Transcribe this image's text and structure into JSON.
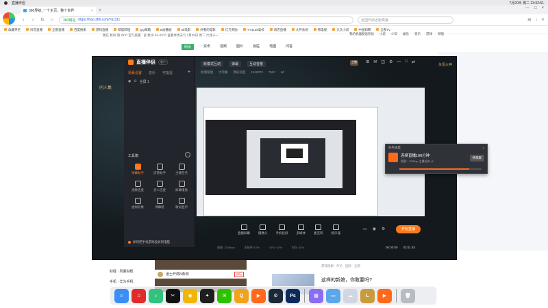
{
  "menubar": {
    "app_name": "直播伴侣",
    "datetime": "7月20日 周二 23:52:51"
  },
  "browser": {
    "tab_title": "360导航_一个主页，整个世界",
    "url_safe": "360网址",
    "url": "https://hao.360.com/?a1111",
    "search_placeholder": "全国开启近距离接",
    "bookmarks": [
      "收藏夹栏",
      "抖音直播",
      "全部直播",
      "百度搜索",
      "游戏直播",
      "哔哩哔哩",
      "QQ邮箱",
      "B站番剧",
      "6k电影",
      "好看的电影",
      "亿元奖励",
      "YY4138高校",
      "商店直播",
      "大伴会场",
      "看电视",
      "久久小说",
      "中国知网",
      "全部TV"
    ],
    "site_header": "我在 杭州  阴 26°C  空气质量 · 良  杭州 24~31°C  查看本周天气  7月20日 周二  六月十一",
    "site_nav": [
      "网页",
      "资讯",
      "视频",
      "图片",
      "良医",
      "地图",
      "问答"
    ],
    "site_nav_active": 0,
    "site_right": [
      "我的机器配送检验",
      "小说",
      "少年",
      "娱乐",
      "音乐",
      "游戏",
      "哔哩"
    ]
  },
  "stream_app": {
    "logo_text": "直播伴侣",
    "version_badge": "客户",
    "side_tabs": [
      "场景设置",
      "音乐",
      "可能是"
    ],
    "scene_label": "全屏 1",
    "tools_title": "工具箱",
    "tools": [
      {
        "label": "弹幕助手",
        "hot": true
      },
      {
        "label": "房管助手",
        "hot": false
      },
      {
        "label": "主播任务",
        "hot": false
      },
      {
        "label": "视频连麦",
        "hot": false
      },
      {
        "label": "多人连麦",
        "hot": false
      },
      {
        "label": "屏幕播放",
        "hot": false
      },
      {
        "label": "虚拟形象",
        "hot": false
      },
      {
        "label": "弹幕姬",
        "hot": false
      },
      {
        "label": "歌词显示",
        "hot": false
      }
    ],
    "footer_tip": "如何把手机游戏投屏到电脑",
    "top_row": [
      "新模式互动",
      "弹幕",
      "互动音量"
    ],
    "top_row2": [
      "新增管理",
      "大荧幕",
      "我的热度",
      "1818372",
      "7597",
      "60"
    ],
    "lol_left": "同人集",
    "lol_right": "永恒大神",
    "avatar_text": "主播",
    "popup": {
      "header": "任务进度",
      "title": "连续直播100分钟",
      "subtitle": "奖励：100Exp 主播任务 x1",
      "button": "待领取",
      "progress": 0.85
    },
    "bottom_controls": [
      "直播屏幕",
      "摄像头",
      "手机投屏",
      "多媒体",
      "麦克风",
      "扬声器"
    ],
    "start_label": "开始直播",
    "status_items": [
      "网络: 113Kbps",
      "丢帧率 0.0%",
      "CPU: 62%",
      "内存: 52%"
    ],
    "timer": [
      "00:00:00",
      "02:01:45"
    ]
  },
  "page": {
    "left_links": [
      "财经 · 风暴财经",
      "手机 · 华为手机"
    ],
    "game_title": "道士开局N条狗",
    "game_tag": "热玩",
    "news_meta": "游戏观察 · 评论 · 国际 · 全部",
    "news_title": "这样的新娘，你敢要吗?"
  },
  "dock": {
    "apps": [
      {
        "name": "finder",
        "color": "#3a8ef5",
        "glyph": "☺"
      },
      {
        "name": "netease-music",
        "color": "#e02b2b",
        "glyph": "♫"
      },
      {
        "name": "qq-music",
        "color": "#31c27c",
        "glyph": "♪"
      },
      {
        "name": "capcut",
        "color": "#111111",
        "glyph": "✂"
      },
      {
        "name": "chrome",
        "color": "#f2b600",
        "glyph": "◉"
      },
      {
        "name": "qq",
        "color": "#1e1e1e",
        "glyph": "✦"
      },
      {
        "name": "wechat",
        "color": "#2dc100",
        "glyph": "✉"
      },
      {
        "name": "app-orange",
        "color": "#f3a21b",
        "glyph": "Q"
      },
      {
        "name": "stream-companion",
        "color": "#ff6a1a",
        "glyph": "▶"
      },
      {
        "name": "steam",
        "color": "#1b2838",
        "glyph": "⚙"
      },
      {
        "name": "photoshop",
        "color": "#0b2a5c",
        "glyph": "Ps"
      },
      {
        "name": "launchpad",
        "color": "#8c6cf0",
        "glyph": "▦"
      },
      {
        "name": "folder",
        "color": "#5aa7ea",
        "glyph": "▭"
      },
      {
        "name": "cloud",
        "color": "#d0d6e2",
        "glyph": "☁"
      },
      {
        "name": "league",
        "color": "#c89b3c",
        "glyph": "L"
      },
      {
        "name": "stream-companion-2",
        "color": "#ff6a1a",
        "glyph": "▶"
      },
      {
        "name": "trash",
        "color": "#b8bcc4",
        "glyph": "🗑"
      }
    ]
  }
}
